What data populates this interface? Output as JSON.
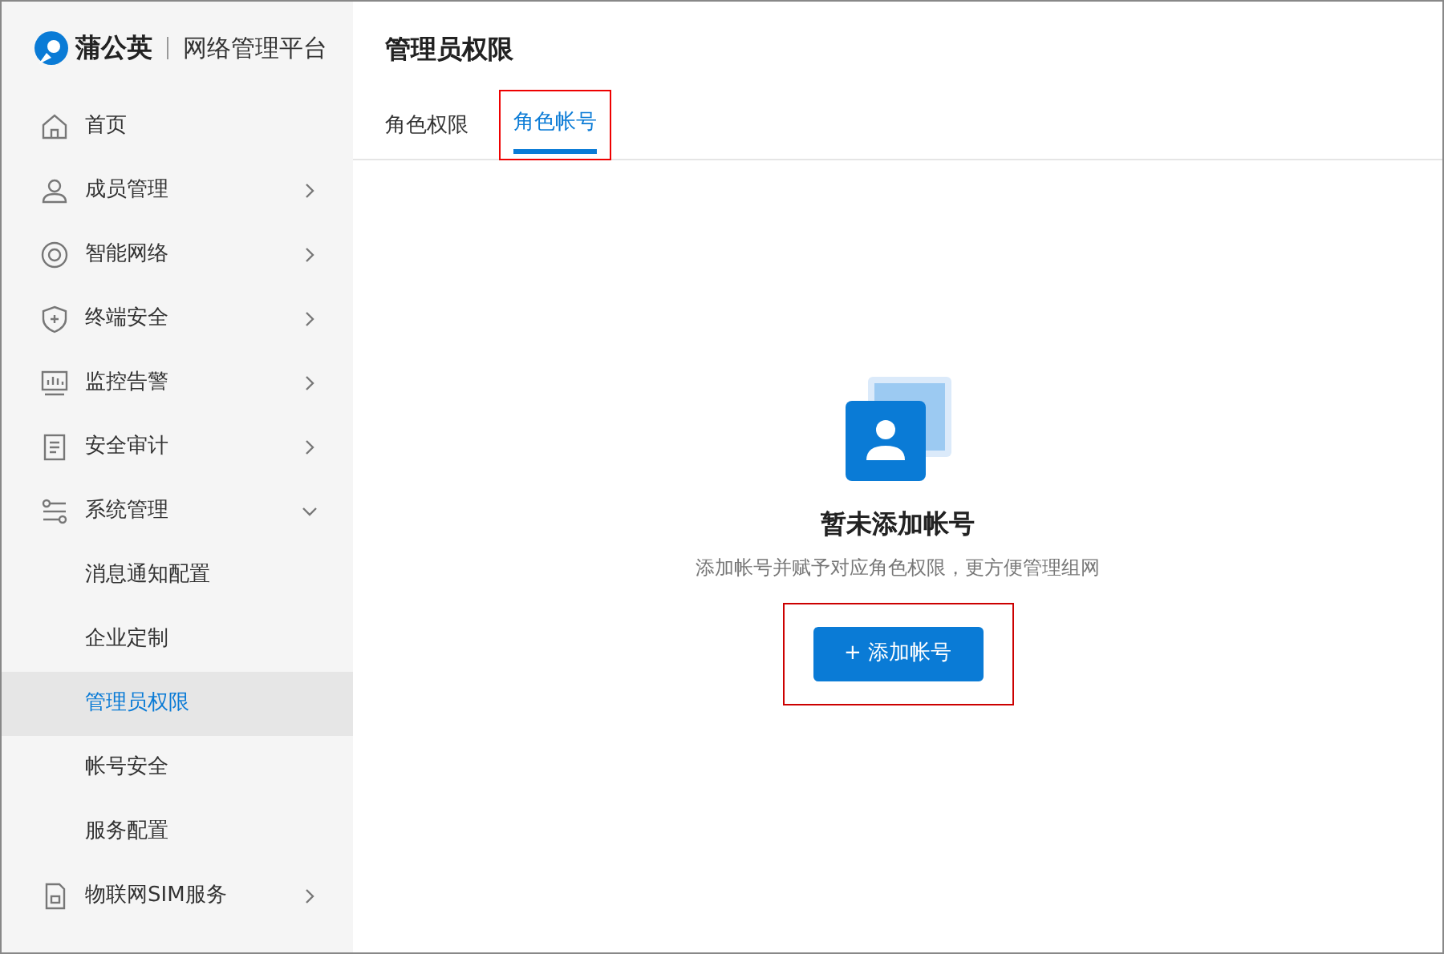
{
  "brand": {
    "name": "蒲公英",
    "product": "网络管理平台"
  },
  "sidebar": {
    "items": [
      {
        "label": "首页",
        "selected": false
      },
      {
        "label": "成员管理",
        "selected": false,
        "expanded": false
      },
      {
        "label": "智能网络",
        "selected": false,
        "expanded": false
      },
      {
        "label": "终端安全",
        "selected": false,
        "expanded": false
      },
      {
        "label": "监控告警",
        "selected": false,
        "expanded": false
      },
      {
        "label": "安全审计",
        "selected": false,
        "expanded": false
      },
      {
        "label": "系统管理",
        "selected": false,
        "expanded": true,
        "children": [
          {
            "label": "消息通知配置",
            "selected": false
          },
          {
            "label": "企业定制",
            "selected": false
          },
          {
            "label": "管理员权限",
            "selected": true
          },
          {
            "label": "帐号安全",
            "selected": false
          },
          {
            "label": "服务配置",
            "selected": false
          }
        ]
      },
      {
        "label": "物联网SIM服务",
        "selected": false,
        "expanded": false
      }
    ]
  },
  "page": {
    "title": "管理员权限"
  },
  "tabs": [
    {
      "label": "角色权限",
      "selected": false,
      "highlighted": false
    },
    {
      "label": "角色帐号",
      "selected": true,
      "highlighted": true
    }
  ],
  "empty_state": {
    "title": "暂未添加帐号",
    "description": "添加帐号并赋予对应角色权限，更方便管理组网",
    "button": {
      "icon": "+",
      "label": "添加帐号",
      "highlighted": true
    }
  }
}
